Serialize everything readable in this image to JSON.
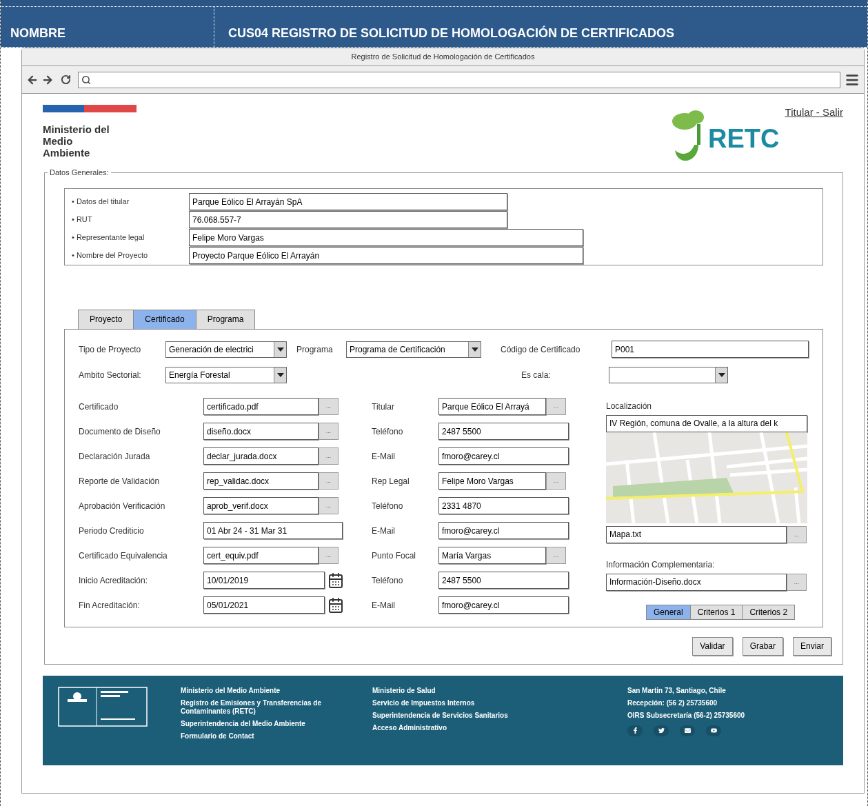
{
  "doc_header": {
    "label": "NOMBRE",
    "title": "CUS04 REGISTRO DE SOLICITUD DE HOMOLOGACIÓN DE CERTIFICADOS"
  },
  "window": {
    "title": "Registro de Solicitud de Homologación de Certificados"
  },
  "site_header": {
    "ministry_lines": [
      "Ministerio del",
      "Medio",
      "Ambiente"
    ],
    "user_link": "Titular - Salir",
    "logo_text": "RETC"
  },
  "general": {
    "legend": "Datos Generales:",
    "fields": [
      {
        "label": "• Datos del titular",
        "value": "Parque Eólico El Arrayán SpA",
        "wide": false
      },
      {
        "label": "• RUT",
        "value": "76.068.557-7",
        "wide": false
      },
      {
        "label": "• Representante legal",
        "value": "Felipe Moro Vargas",
        "wide": true
      },
      {
        "label": "• Nombre del Proyecto",
        "value": "Proyecto Parque Eólico El Arrayán",
        "wide": true
      }
    ]
  },
  "tabs": [
    {
      "label": "Proyecto",
      "selected": false
    },
    {
      "label": "Certificado",
      "selected": true
    },
    {
      "label": "Programa",
      "selected": false
    }
  ],
  "top_row": {
    "tipo_label": "Tipo de Proyecto",
    "tipo_value": "Generación de electrici",
    "programa_label": "Programa",
    "programa_value": "Programa de Certificación",
    "codigo_label": "Código de Certificado",
    "codigo_value": "P001"
  },
  "second_row": {
    "ambito_label": "Ambito Sectorial:",
    "ambito_value": "Energía Forestal",
    "escala_label": "Es cala:"
  },
  "left_rows": [
    {
      "kind": "file",
      "label": "Certificado",
      "value": "certificado.pdf",
      "button": "..."
    },
    {
      "kind": "file",
      "label": "Documento de Diseño",
      "value": "diseño.docx",
      "button": "..."
    },
    {
      "kind": "file",
      "label": "Declaración Jurada",
      "value": "declar_jurada.docx",
      "button": "..."
    },
    {
      "kind": "file",
      "label": "Reporte de Validación",
      "value": "rep_validac.docx",
      "button": "..."
    },
    {
      "kind": "file",
      "label": "Aprobación Verificación",
      "value": "aprob_verif.docx",
      "button": "..."
    },
    {
      "kind": "text",
      "label": "Periodo Crediticio",
      "value": "01 Abr 24 - 31 Mar 31"
    },
    {
      "kind": "file",
      "label": "Certificado Equivalencia",
      "value": "cert_equiv.pdf",
      "button": "..."
    },
    {
      "kind": "date",
      "label": "Inicio Acreditación:",
      "value": "10/01/2019"
    },
    {
      "kind": "date",
      "label": "Fin Acreditación:",
      "value": "05/01/2021"
    }
  ],
  "middle_rows": [
    {
      "kind": "file",
      "label": "Titular",
      "value": "Parque Eólico El Arrayá",
      "button": "..."
    },
    {
      "kind": "text",
      "label": "Teléfono",
      "value": "2487 5500"
    },
    {
      "kind": "text",
      "label": "E-Mail",
      "value": "fmoro@carey.cl"
    },
    {
      "kind": "file",
      "label": "Rep Legal",
      "value": "Felipe Moro Vargas",
      "button": "..."
    },
    {
      "kind": "text",
      "label": "Teléfono",
      "value": "2331  4870"
    },
    {
      "kind": "text",
      "label": "E-Mail",
      "value": "fmoro@carey.cl"
    },
    {
      "kind": "file",
      "label": "Punto Focal",
      "value": "María  Vargas",
      "button": "..."
    },
    {
      "kind": "text",
      "label": "Teléfono",
      "value": "2487 5500"
    },
    {
      "kind": "text",
      "label": "E-Mail",
      "value": "fmoro@carey.cl"
    }
  ],
  "location": {
    "label": "Localización",
    "value": "IV Región, comuna de Ovalle, a la altura del k",
    "map_file": "Mapa.txt",
    "map_button": "...",
    "info_label": "Información Complementaria:",
    "info_file": "Información-Diseño.docx",
    "info_button": "..."
  },
  "subtabs": [
    {
      "label": "General",
      "selected": true
    },
    {
      "label": "Criterios 1",
      "selected": false
    },
    {
      "label": "Criterios 2",
      "selected": false
    }
  ],
  "actions": [
    "Validar",
    "Grabar",
    "Enviar"
  ],
  "footer": {
    "columns": [
      [
        "Ministerio del Medio Ambiente",
        "Registro de Emisiones y Transferencias de Contaminantes (RETC)",
        "Superintendencia del Medio Ambiente",
        "Formulario de Contact"
      ],
      [
        "Ministerio de Salud",
        "Servicio de Impuestos Internos",
        "Superintendencia de Servicios Sanitarios",
        "Acceso Administrativo"
      ],
      [
        "San Martin 73, Santiago, Chile",
        "Recepción: (56 2) 25735600",
        "OIRS Subsecretaría (56-2) 25735600"
      ]
    ]
  }
}
